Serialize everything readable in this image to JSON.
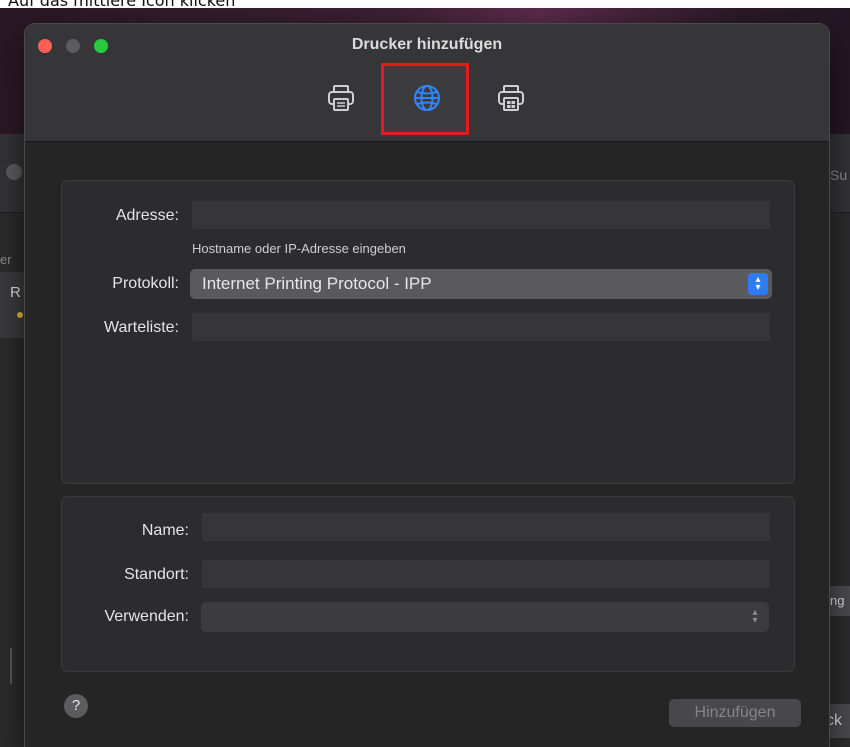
{
  "caption": "Auf das mittlere Icon klicken",
  "background": {
    "partial_su": "Su",
    "partial_er": "er",
    "partial_r": "R",
    "partial_ung": "ng",
    "partial_cke": "ck"
  },
  "dialog": {
    "title": "Drucker hinzufügen",
    "toolbar": {
      "items": [
        {
          "icon": "printer-icon",
          "selected": false
        },
        {
          "icon": "globe-icon",
          "selected": true
        },
        {
          "icon": "windows-printer-icon",
          "selected": false
        }
      ]
    },
    "top_panel": {
      "address_label": "Adresse:",
      "address_value": "",
      "address_hint": "Hostname oder IP-Adresse eingeben",
      "protocol_label": "Protokoll:",
      "protocol_value": "Internet Printing Protocol - IPP",
      "queue_label": "Warteliste:",
      "queue_value": ""
    },
    "bottom_panel": {
      "name_label": "Name:",
      "name_value": "",
      "location_label": "Standort:",
      "location_value": "",
      "use_label": "Verwenden:",
      "use_value": ""
    },
    "help_label": "?",
    "add_button": "Hinzufügen"
  },
  "colors": {
    "highlight": "#e8191b",
    "accent": "#2d7cf6",
    "window_bg": "#252526"
  }
}
